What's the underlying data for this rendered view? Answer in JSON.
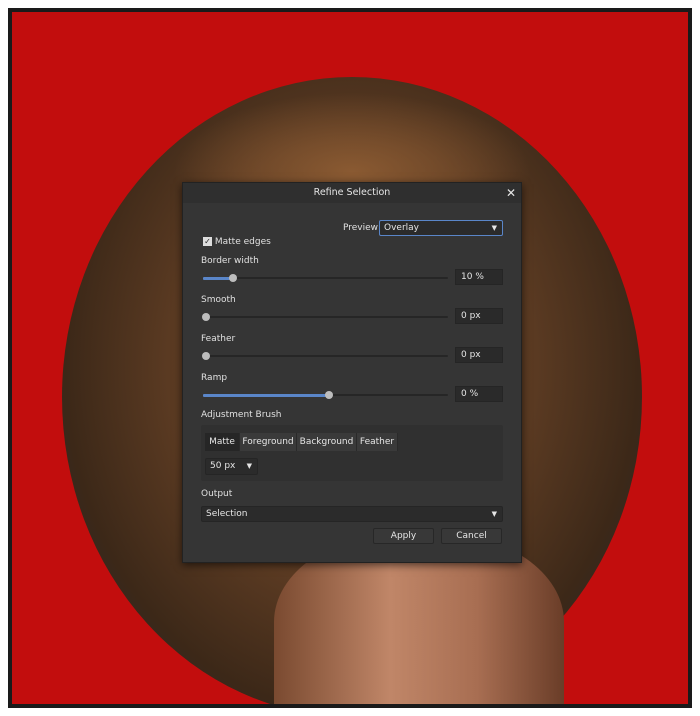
{
  "dialog": {
    "title": "Refine Selection",
    "close_icon": "close-icon",
    "preview_label": "Preview",
    "preview_value": "Overlay",
    "matte_edges_label": "Matte edges",
    "matte_edges_checked": true,
    "sliders": [
      {
        "label": "Border width",
        "value": "10 %",
        "level": 0.11
      },
      {
        "label": "Smooth",
        "value": "0 px",
        "level": 0
      },
      {
        "label": "Feather",
        "value": "0 px",
        "level": 0
      },
      {
        "label": "Ramp",
        "value": "0 %",
        "level": 0.5
      }
    ],
    "brush_label": "Adjustment Brush",
    "brush_tabs": [
      "Matte",
      "Foreground",
      "Background",
      "Feather"
    ],
    "brush_selected": "Matte",
    "brush_size": "50 px",
    "output_label": "Output",
    "output_value": "Selection",
    "apply": "Apply",
    "cancel": "Cancel",
    "accent": "#5a86c9"
  }
}
